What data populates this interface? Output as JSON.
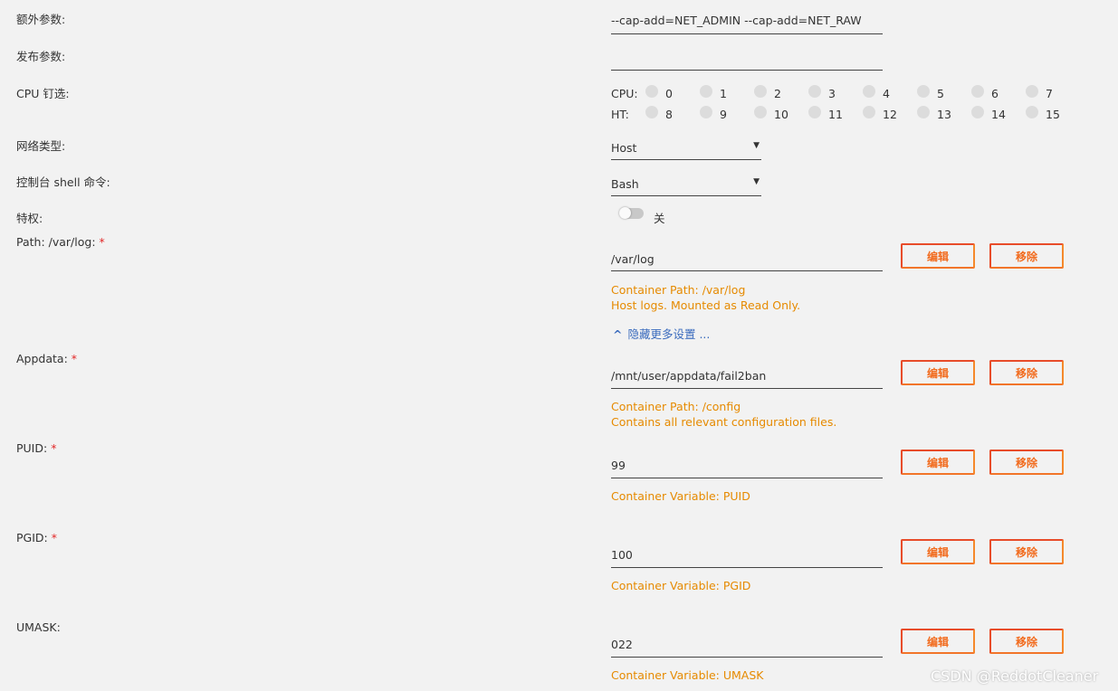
{
  "extra_params": {
    "label": "额外参数:",
    "value": "--cap-add=NET_ADMIN --cap-add=NET_RAW"
  },
  "post_params": {
    "label": "发布参数:",
    "value": ""
  },
  "cpu_pinning": {
    "label": "CPU 钉选:",
    "cpu_tag": "CPU:",
    "ht_tag": "HT:",
    "cpu_cores": [
      "0",
      "1",
      "2",
      "3",
      "4",
      "5",
      "6",
      "7"
    ],
    "ht_cores": [
      "8",
      "9",
      "10",
      "11",
      "12",
      "13",
      "14",
      "15"
    ]
  },
  "network_type": {
    "label": "网络类型:",
    "value": "Host",
    "arrow": "▼"
  },
  "console_shell": {
    "label": "控制台 shell 命令:",
    "value": "Bash",
    "arrow": "▼"
  },
  "privileged": {
    "label": "特权:",
    "state_text": "关"
  },
  "buttons": {
    "edit": "编辑",
    "remove": "移除"
  },
  "required_mark": "*",
  "path_log": {
    "label": "Path: /var/log:",
    "value": "/var/log",
    "note1": "Container Path: /var/log",
    "note2": "Host logs. Mounted as Read Only."
  },
  "more_settings": {
    "chevron": "^",
    "text": "隐藏更多设置 ..."
  },
  "appdata": {
    "label": "Appdata:",
    "value": "/mnt/user/appdata/fail2ban",
    "note1": "Container Path: /config",
    "note2": "Contains all relevant configuration files."
  },
  "puid": {
    "label": "PUID:",
    "value": "99",
    "note1": "Container Variable: PUID"
  },
  "pgid": {
    "label": "PGID:",
    "value": "100",
    "note1": "Container Variable: PGID"
  },
  "umask": {
    "label": "UMASK:",
    "value": "022",
    "note1": "Container Variable: UMASK"
  },
  "watermark": "CSDN @ReddotCleaner",
  "colors": {
    "accent_orange": "#f26b1d",
    "note_orange": "#e68a00",
    "link_blue": "#3a6bbd",
    "required_red": "#e22828"
  }
}
